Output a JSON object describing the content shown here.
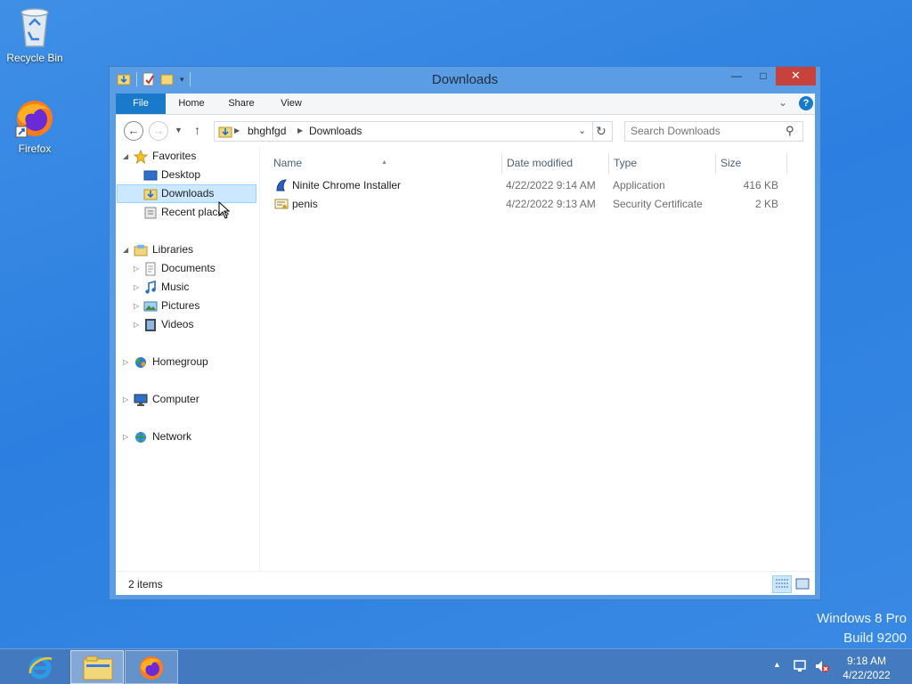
{
  "desktop": {
    "icons": [
      {
        "label": "Recycle Bin",
        "icon": "recycle-bin-icon"
      },
      {
        "label": "Firefox",
        "icon": "firefox-icon"
      }
    ],
    "watermark_line1": "Windows 8 Pro",
    "watermark_line2": "Build 9200"
  },
  "window": {
    "title": "Downloads",
    "controls": {
      "minimize": "—",
      "maximize": "□",
      "close": "✕"
    },
    "ribbon_tabs": [
      "File",
      "Home",
      "Share",
      "View"
    ],
    "address": {
      "crumbs": [
        "bhghfgd",
        "Downloads"
      ]
    },
    "search": {
      "placeholder": "Search Downloads"
    },
    "nav_pane": {
      "favorites": {
        "label": "Favorites",
        "items": [
          "Desktop",
          "Downloads",
          "Recent places"
        ]
      },
      "libraries": {
        "label": "Libraries",
        "items": [
          "Documents",
          "Music",
          "Pictures",
          "Videos"
        ]
      },
      "homegroup": "Homegroup",
      "computer": "Computer",
      "network": "Network"
    },
    "columns": [
      "Name",
      "Date modified",
      "Type",
      "Size"
    ],
    "files": [
      {
        "name": "Ninite Chrome Installer",
        "date": "4/22/2022 9:14 AM",
        "type": "Application",
        "size": "416 KB",
        "icon": "installer-icon"
      },
      {
        "name": "penis",
        "date": "4/22/2022 9:13 AM",
        "type": "Security Certificate",
        "size": "2 KB",
        "icon": "certificate-icon"
      }
    ],
    "status": {
      "item_count": "2 items"
    }
  },
  "taskbar": {
    "apps": [
      "internet-explorer-icon",
      "file-explorer-icon",
      "firefox-icon"
    ],
    "clock": {
      "time": "9:18 AM",
      "date": "4/22/2022"
    }
  },
  "colors": {
    "accent": "#1979ca",
    "selection": "#cce8ff",
    "close_button": "#c7423a",
    "desktop": "#2c7fe0"
  }
}
